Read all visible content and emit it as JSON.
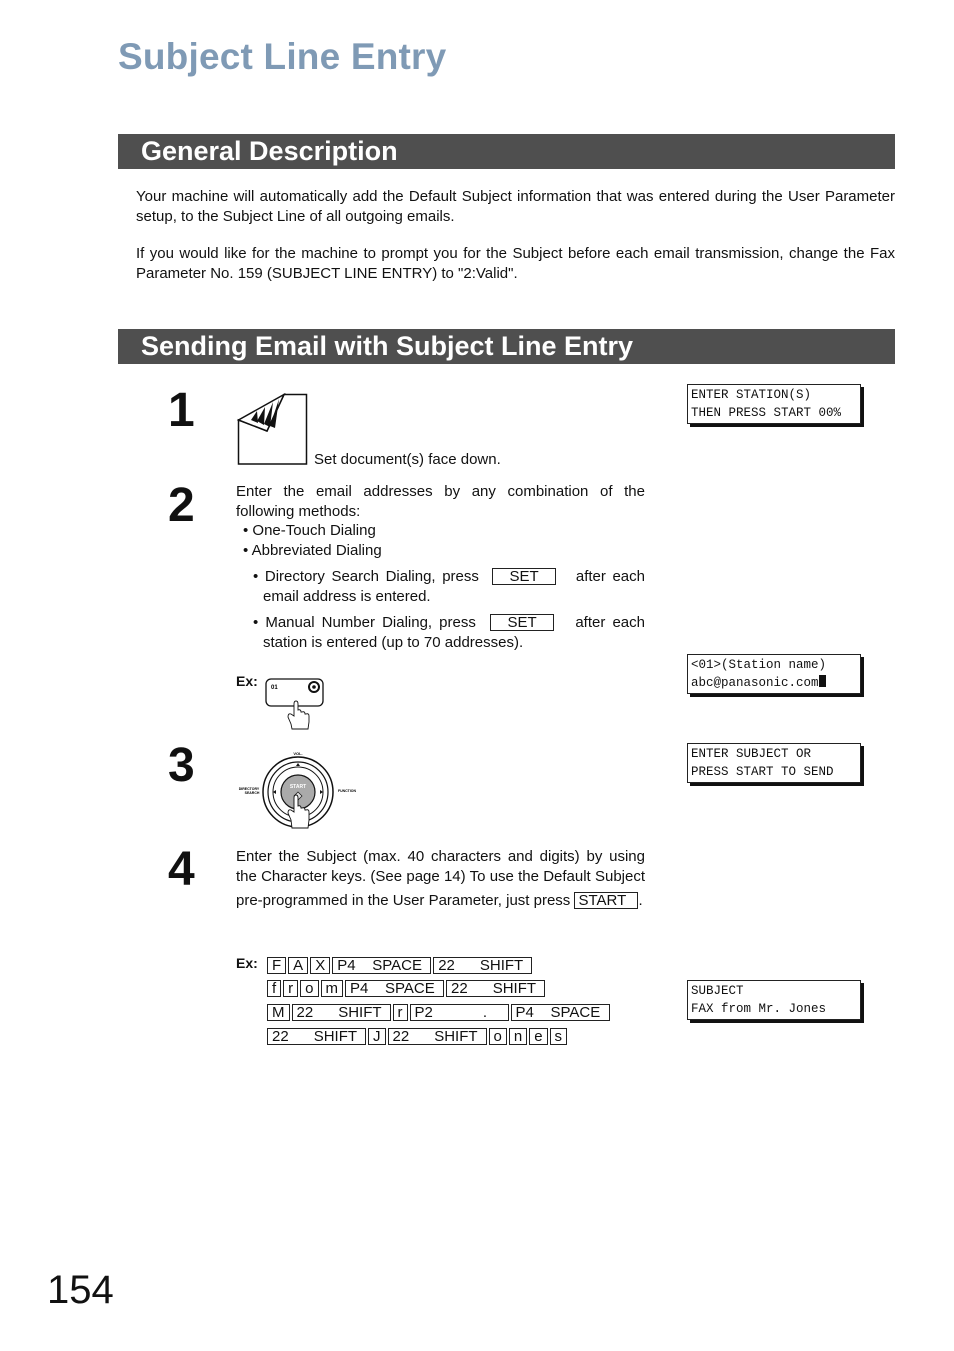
{
  "page": {
    "title": "Subject Line Entry",
    "page_number": "154"
  },
  "general": {
    "heading": "General Description",
    "para1": "Your machine will automatically add the Default Subject information that was entered during the User Parameter setup, to the Subject Line of all outgoing emails.",
    "para2": "If you would like for the machine to prompt you for the Subject before each email transmission, change the Fax Parameter No. 159 (SUBJECT LINE ENTRY) to \"2:Valid\"."
  },
  "sending": {
    "heading": "Sending Email with Subject Line Entry",
    "steps": [
      {
        "number": "1",
        "icon": "document-face-down-icon",
        "text": "Set document(s) face down.",
        "lcd": [
          "ENTER STATION(S)",
          "THEN PRESS START 00%"
        ]
      },
      {
        "number": "2",
        "intro": "Enter the email addresses by any combination of the following methods:",
        "bullets": [
          {
            "text": "One-Touch Dialing"
          },
          {
            "text": "Abbreviated Dialing"
          },
          {
            "pre": "Directory Search Dialing, press",
            "key": "SET",
            "post": "after each email address is entered."
          },
          {
            "pre": "Manual Number Dialing, press",
            "key": "SET",
            "post": "after each station is entered (up to 70 addresses)."
          }
        ],
        "ex_label": "Ex:",
        "ex_key_label": "01",
        "lcd": [
          "<01>(Station name)",
          "abc@panasonic.com"
        ]
      },
      {
        "number": "3",
        "dial": {
          "top": "VOL.",
          "left": "DIRECTORY SEARCH",
          "right": "FUNCTION",
          "center": "START"
        },
        "lcd": [
          "ENTER SUBJECT OR",
          "PRESS START TO SEND"
        ]
      },
      {
        "number": "4",
        "text": "Enter the Subject (max. 40 characters and digits) by using the Character keys. (See page 14)  To use the Default Subject pre-programmed in the User Parameter, just press",
        "key": "START",
        "text_end": ".",
        "ex_label": "Ex:",
        "key_rows": [
          [
            "F",
            "A",
            "X",
            "P4    SPACE",
            "22      SHIFT"
          ],
          [
            "f",
            "r",
            "o",
            "m",
            "P4    SPACE",
            "22      SHIFT"
          ],
          [
            "M",
            "22      SHIFT",
            "r",
            "P2            .",
            "P4    SPACE"
          ],
          [
            "22      SHIFT",
            "J",
            "22      SHIFT",
            "o",
            "n",
            "e",
            "s"
          ]
        ],
        "lcd": [
          "SUBJECT",
          "FAX from Mr. Jones"
        ]
      }
    ]
  }
}
